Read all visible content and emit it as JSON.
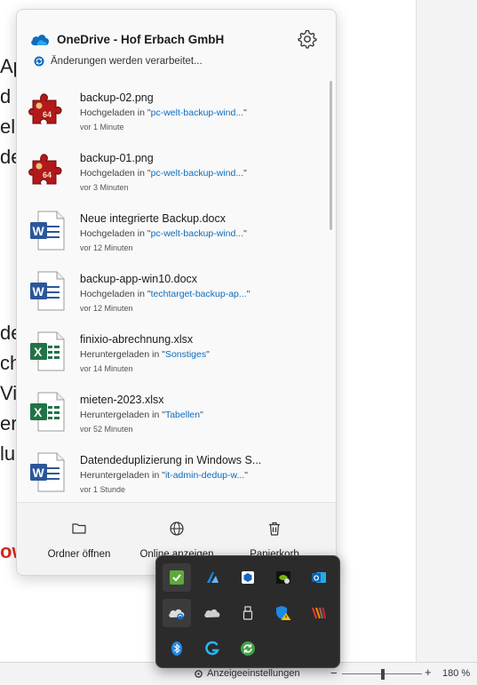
{
  "background_doc": {
    "fragments": [
      "Ap",
      "d",
      "elle",
      "de",
      "de",
      "ch",
      "Vi",
      "er",
      "lu",
      "ow"
    ]
  },
  "onedrive": {
    "account": "OneDrive - Hof Erbach GmbH",
    "status": "Änderungen werden verarbeitet...",
    "files": [
      {
        "name": "backup-02.png",
        "action": "Hochgeladen in",
        "folder": "pc-welt-backup-wind...",
        "time": "vor 1 Minute",
        "icon": "jigsaw-64-icon"
      },
      {
        "name": "backup-01.png",
        "action": "Hochgeladen in",
        "folder": "pc-welt-backup-wind...",
        "time": "vor 3 Minuten",
        "icon": "jigsaw-64-icon"
      },
      {
        "name": "Neue integrierte Backup.docx",
        "action": "Hochgeladen in",
        "folder": "pc-welt-backup-wind...",
        "time": "vor 12 Minuten",
        "icon": "word-icon"
      },
      {
        "name": "backup-app-win10.docx",
        "action": "Hochgeladen in",
        "folder": "techtarget-backup-ap...",
        "time": "vor 12 Minuten",
        "icon": "word-icon"
      },
      {
        "name": "finixio-abrechnung.xlsx",
        "action": "Heruntergeladen in",
        "folder": "Sonstiges",
        "time": "vor 14 Minuten",
        "icon": "excel-icon"
      },
      {
        "name": "mieten-2023.xlsx",
        "action": "Heruntergeladen in",
        "folder": "Tabellen",
        "time": "vor 52 Minuten",
        "icon": "excel-icon"
      },
      {
        "name": "Datendeduplizierung in Windows S...",
        "action": "Heruntergeladen in",
        "folder": "it-admin-dedup-w...",
        "time": "vor 1 Stunde",
        "icon": "word-icon"
      }
    ],
    "footer": {
      "open_folder": "Ordner öffnen",
      "view_online": "Online anzeigen",
      "recycle_bin": "Papierkorb"
    }
  },
  "statusbar": {
    "display_settings": "Anzeigeeinstellungen",
    "zoom": "180 %"
  },
  "tray_icons": [
    "shield-check-icon",
    "azure-icon",
    "cube-icon",
    "nvidia-icon",
    "outlook-icon",
    "onedrive-sync-icon",
    "cloud-icon",
    "usb-icon",
    "defender-warning-icon",
    "stripes-icon",
    "bluetooth-icon",
    "logitech-g-icon",
    "refresh-green-icon"
  ]
}
